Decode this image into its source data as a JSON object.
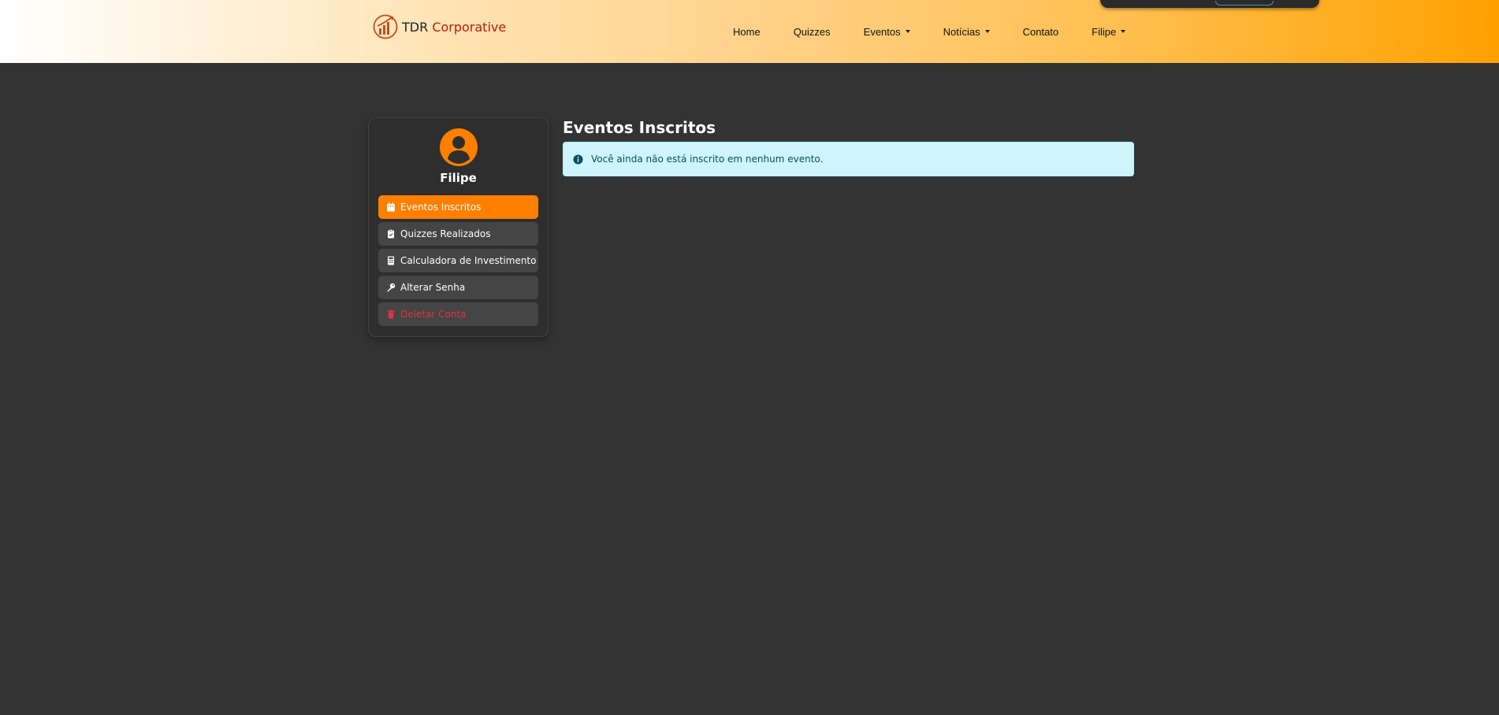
{
  "brand": {
    "name_part1": "TDR",
    "name_part2": "Corporative",
    "accent": "#b51d0a"
  },
  "nav": {
    "items": [
      {
        "label": "Home",
        "dropdown": false
      },
      {
        "label": "Quizzes",
        "dropdown": false
      },
      {
        "label": "Eventos",
        "dropdown": true
      },
      {
        "label": "Notícias",
        "dropdown": true
      },
      {
        "label": "Contato",
        "dropdown": false
      },
      {
        "label": "Filipe",
        "dropdown": true
      }
    ]
  },
  "sidebar": {
    "avatar_icon": "user-circle-icon",
    "username": "Filipe",
    "items": [
      {
        "label": "Eventos Inscritos",
        "icon": "calendar-icon",
        "active": true
      },
      {
        "label": "Quizzes Realizados",
        "icon": "clipboard-check-icon",
        "active": false
      },
      {
        "label": "Calculadora de Investimento",
        "icon": "calculator-icon",
        "active": false
      },
      {
        "label": "Alterar Senha",
        "icon": "key-icon",
        "active": false
      },
      {
        "label": "Deletar Conta",
        "icon": "trash-icon",
        "active": false,
        "danger": true
      }
    ]
  },
  "main": {
    "title": "Eventos Inscritos",
    "alert": {
      "icon": "info-circle-icon",
      "text": "Você ainda não está inscrito em nenhum evento."
    }
  },
  "colors": {
    "accent": "#ff7f00",
    "background": "#333333",
    "alert_bg": "#cff4fc",
    "alert_text": "#055160",
    "danger": "#dc3545"
  }
}
